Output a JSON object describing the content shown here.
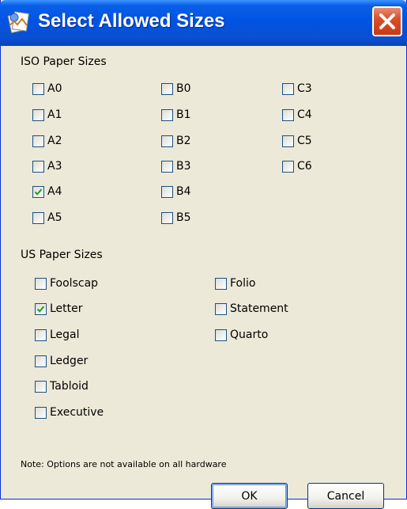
{
  "window": {
    "title": "Select Allowed Sizes"
  },
  "iso": {
    "label": "ISO Paper Sizes",
    "columns": [
      [
        {
          "label": "A0",
          "checked": false
        },
        {
          "label": "A1",
          "checked": false
        },
        {
          "label": "A2",
          "checked": false
        },
        {
          "label": "A3",
          "checked": false
        },
        {
          "label": "A4",
          "checked": true
        },
        {
          "label": "A5",
          "checked": false
        }
      ],
      [
        {
          "label": "B0",
          "checked": false
        },
        {
          "label": "B1",
          "checked": false
        },
        {
          "label": "B2",
          "checked": false
        },
        {
          "label": "B3",
          "checked": false
        },
        {
          "label": "B4",
          "checked": false
        },
        {
          "label": "B5",
          "checked": false
        }
      ],
      [
        {
          "label": "C3",
          "checked": false
        },
        {
          "label": "C4",
          "checked": false
        },
        {
          "label": "C5",
          "checked": false
        },
        {
          "label": "C6",
          "checked": false
        }
      ]
    ]
  },
  "us": {
    "label": "US Paper Sizes",
    "columns": [
      [
        {
          "label": "Foolscap",
          "checked": false
        },
        {
          "label": "Letter",
          "checked": true
        },
        {
          "label": "Legal",
          "checked": false
        },
        {
          "label": "Ledger",
          "checked": false
        },
        {
          "label": "Tabloid",
          "checked": false
        },
        {
          "label": "Executive",
          "checked": false
        }
      ],
      [
        {
          "label": "Folio",
          "checked": false
        },
        {
          "label": "Statement",
          "checked": false
        },
        {
          "label": "Quarto",
          "checked": false
        }
      ]
    ]
  },
  "note": "Note: Options are not available on all hardware",
  "buttons": {
    "ok": "OK",
    "cancel": "Cancel"
  },
  "icons": {
    "app": "paper-sizes-app-icon",
    "close": "close-icon",
    "check": "checkmark-icon"
  },
  "colors": {
    "title_bar": "#0054e3",
    "dialog_bg": "#ece9d8",
    "close_button": "#d84f2a",
    "check": "#21a121"
  }
}
